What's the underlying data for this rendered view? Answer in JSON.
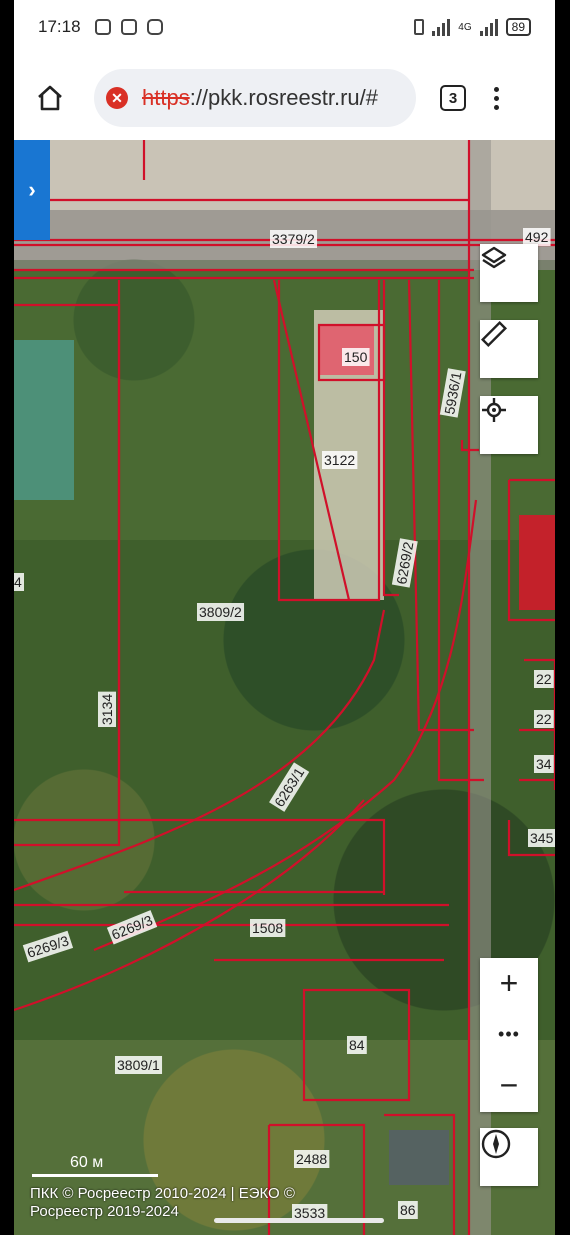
{
  "status_bar": {
    "time": "17:18",
    "network": "4G",
    "battery": "89"
  },
  "browser": {
    "url_scheme": "https",
    "url_rest": "://pkk.rosreestr.ru/#",
    "tab_count": "3"
  },
  "map": {
    "parcel_labels": [
      "3379/2",
      "492",
      "150",
      "5936/1",
      "3122",
      "6269/2",
      "3809/2",
      "3134",
      "6263/1",
      "22",
      "22",
      "34",
      "345",
      "6269/3",
      "6269/3",
      "1508",
      "84",
      "3809/1",
      "2488",
      "3533",
      "86",
      "4"
    ],
    "scale_label": "60 м",
    "copyright": "ПКК © Росреестр 2010-2024 | ЕЭКО © Росреестр 2019-2024"
  },
  "icons": {
    "expand_panel": "chevron-right-icon",
    "layers": "layers-icon",
    "measure": "ruler-icon",
    "locate": "location-target-icon",
    "zoom_in": "plus-icon",
    "zoom_more": "more-icon",
    "zoom_out": "minus-icon",
    "compass": "compass-icon"
  },
  "colors": {
    "parcel_border": "#d0102a",
    "side_tab": "#1976d2",
    "insecure": "#d93025"
  }
}
